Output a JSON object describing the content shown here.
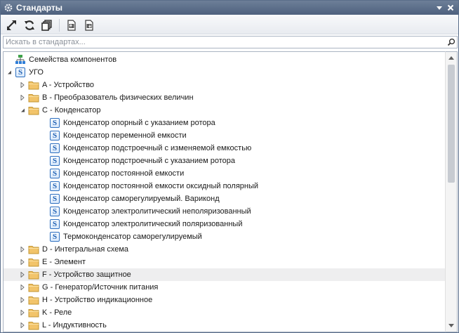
{
  "window": {
    "title": "Стандарты",
    "icon": "gear-icon"
  },
  "toolbar": {
    "buttons": [
      {
        "name": "link-button",
        "icon": "link-arrows-icon"
      },
      {
        "name": "refresh-button",
        "icon": "refresh-icon"
      },
      {
        "name": "collapse-button",
        "icon": "copy-stack-icon"
      },
      {
        "name": "import-button",
        "icon": "doc-import-icon"
      },
      {
        "name": "export-button",
        "icon": "doc-export-icon"
      }
    ]
  },
  "search": {
    "placeholder": "Искать в стандартах...",
    "value": ""
  },
  "tree": {
    "items": [
      {
        "label": "Семейства компонентов",
        "icon": "hierarchy-icon",
        "level": 0,
        "expander": "none"
      },
      {
        "label": "УГО",
        "icon": "standard-s-icon",
        "level": 0,
        "expander": "expanded"
      },
      {
        "label": "A - Устройство",
        "icon": "folder-icon",
        "level": 1,
        "expander": "collapsed"
      },
      {
        "label": "B - Преобразователь физических величин",
        "icon": "folder-icon",
        "level": 1,
        "expander": "collapsed"
      },
      {
        "label": "C - Конденсатор",
        "icon": "folder-icon",
        "level": 1,
        "expander": "expanded"
      },
      {
        "label": "Конденсатор опорный с указанием ротора",
        "icon": "standard-s-icon",
        "level": 2,
        "expander": "none"
      },
      {
        "label": "Конденсатор переменной емкости",
        "icon": "standard-s-icon",
        "level": 2,
        "expander": "none"
      },
      {
        "label": "Конденсатор подстроечный с изменяемой емкостью",
        "icon": "standard-s-icon",
        "level": 2,
        "expander": "none"
      },
      {
        "label": "Конденсатор подстроечный с указанием ротора",
        "icon": "standard-s-icon",
        "level": 2,
        "expander": "none"
      },
      {
        "label": "Конденсатор постоянной емкости",
        "icon": "standard-s-icon",
        "level": 2,
        "expander": "none"
      },
      {
        "label": "Конденсатор постоянной емкости оксидный полярный",
        "icon": "standard-s-icon",
        "level": 2,
        "expander": "none"
      },
      {
        "label": "Конденсатор саморегулируемый. Варикond",
        "icon": "standard-s-icon",
        "level": 2,
        "expander": "none"
      },
      {
        "label": "Конденсатор электролитический неполяризованный",
        "icon": "standard-s-icon",
        "level": 2,
        "expander": "none"
      },
      {
        "label": "Конденсатор электролитический поляризованный",
        "icon": "standard-s-icon",
        "level": 2,
        "expander": "none"
      },
      {
        "label": "Термоконденсатор саморегулируемый",
        "icon": "standard-s-icon",
        "level": 2,
        "expander": "none"
      },
      {
        "label": "D - Интегральная схема",
        "icon": "folder-icon",
        "level": 1,
        "expander": "collapsed"
      },
      {
        "label": "E - Элемент",
        "icon": "folder-icon",
        "level": 1,
        "expander": "collapsed"
      },
      {
        "label": "F - Устройство защитное",
        "icon": "folder-icon",
        "level": 1,
        "expander": "collapsed",
        "hover": true
      },
      {
        "label": "G - Генератор/Источник питания",
        "icon": "folder-icon",
        "level": 1,
        "expander": "collapsed"
      },
      {
        "label": "H - Устройство индикационное",
        "icon": "folder-icon",
        "level": 1,
        "expander": "collapsed"
      },
      {
        "label": "K - Реле",
        "icon": "folder-icon",
        "level": 1,
        "expander": "collapsed"
      },
      {
        "label": "L - Индуктивность",
        "icon": "folder-icon",
        "level": 1,
        "expander": "collapsed"
      }
    ]
  },
  "colors": {
    "titlebar": "#5a6d89",
    "hover_row": "#eeeeef",
    "folder": "#f2c46a",
    "standard_icon": "#2e6fbf"
  }
}
